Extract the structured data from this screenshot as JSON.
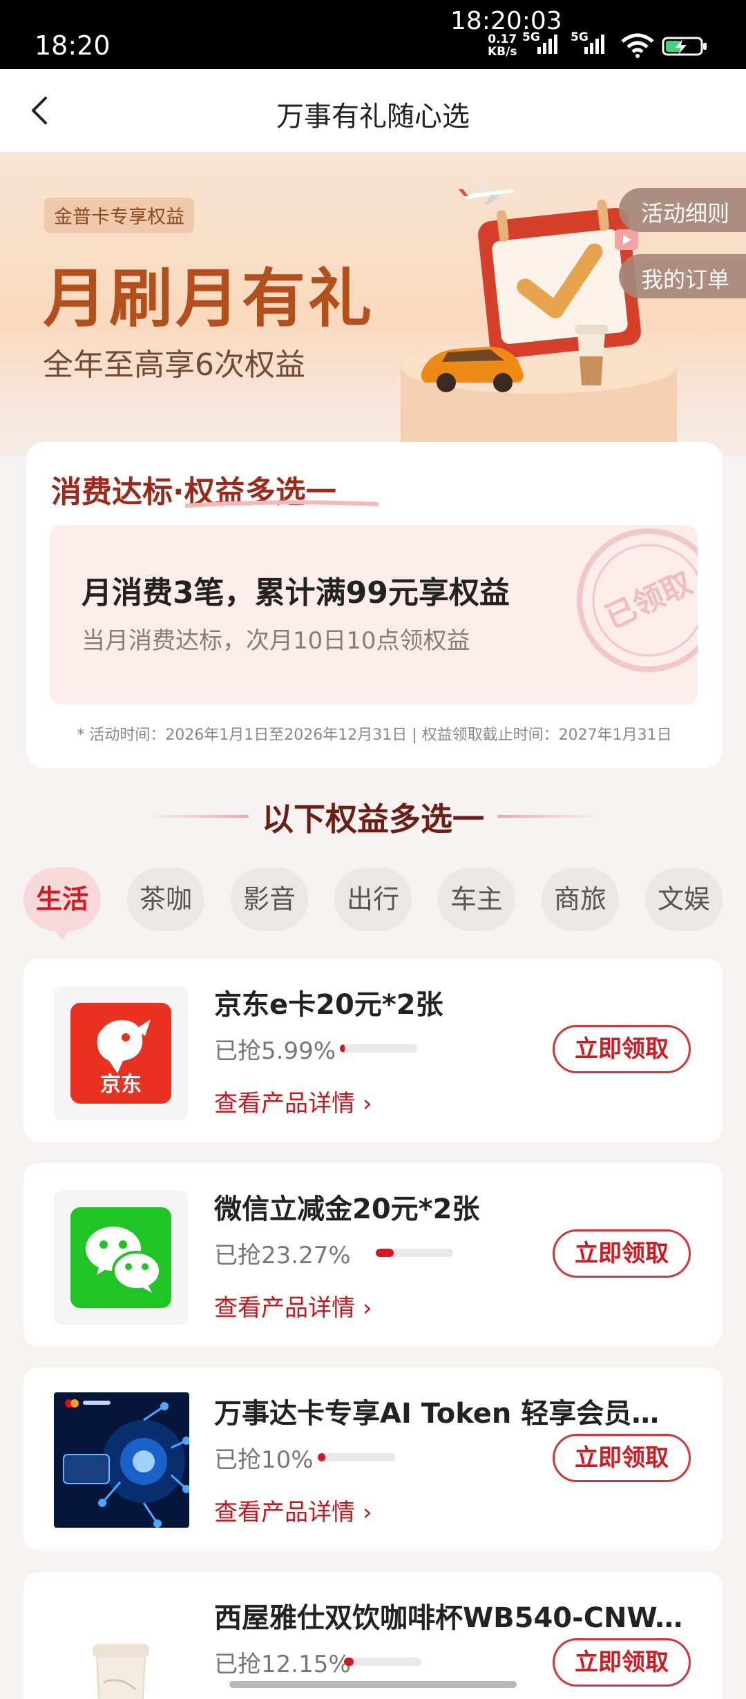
{
  "status_bar": {
    "time": "18:20",
    "clock": "18:20:03",
    "net_speed_value": "0.17",
    "net_speed_unit": "KB/s",
    "net_label_1": "5G",
    "net_label_2": "5G"
  },
  "nav": {
    "title": "万事有礼随心选"
  },
  "banner": {
    "badge": "金普卡专享权益",
    "title": "月刷月有礼",
    "subtitle": "全年至高享6次权益",
    "rules_button": "活动细则",
    "orders_button": "我的订单"
  },
  "rule_card": {
    "heading": "消费达标·权益多选一",
    "main": "月消费3笔，累计满99元享权益",
    "sub": "当月消费达标，次月10日10点领权益",
    "stamp": "已领取",
    "note": "* 活动时间：2026年1月1日至2026年12月31日 | 权益领取截止时间：2027年1月31日"
  },
  "section": {
    "heading": "以下权益多选一"
  },
  "tabs": [
    {
      "label": "生活",
      "active": true
    },
    {
      "label": "茶咖",
      "active": false
    },
    {
      "label": "影音",
      "active": false
    },
    {
      "label": "出行",
      "active": false
    },
    {
      "label": "车主",
      "active": false
    },
    {
      "label": "商旅",
      "active": false
    },
    {
      "label": "文娱",
      "active": false
    }
  ],
  "products": [
    {
      "name": "京东e卡20元*2张",
      "taken": "已抢5.99%",
      "progress": 0.0599,
      "link": "查看产品详情",
      "button": "立即领取",
      "logo_text": "京东"
    },
    {
      "name": "微信立减金20元*2张",
      "taken": "已抢23.27%",
      "progress": 0.2327,
      "link": "查看产品详情",
      "button": "立即领取"
    },
    {
      "name": "万事达卡专享AI Token 轻享会员（...",
      "taken": "已抢10%",
      "progress": 0.1,
      "link": "查看产品详情",
      "button": "立即领取"
    },
    {
      "name": "西屋雅仕双饮咖啡杯WB540-CNW...",
      "taken": "已抢12.15%",
      "progress": 0.1215,
      "link": "查看产品详情",
      "button": "立即领取"
    }
  ],
  "colors": {
    "brand_red": "#d4181f",
    "banner_title": "#b24f1a",
    "rule_heading": "#9b2a1a"
  }
}
